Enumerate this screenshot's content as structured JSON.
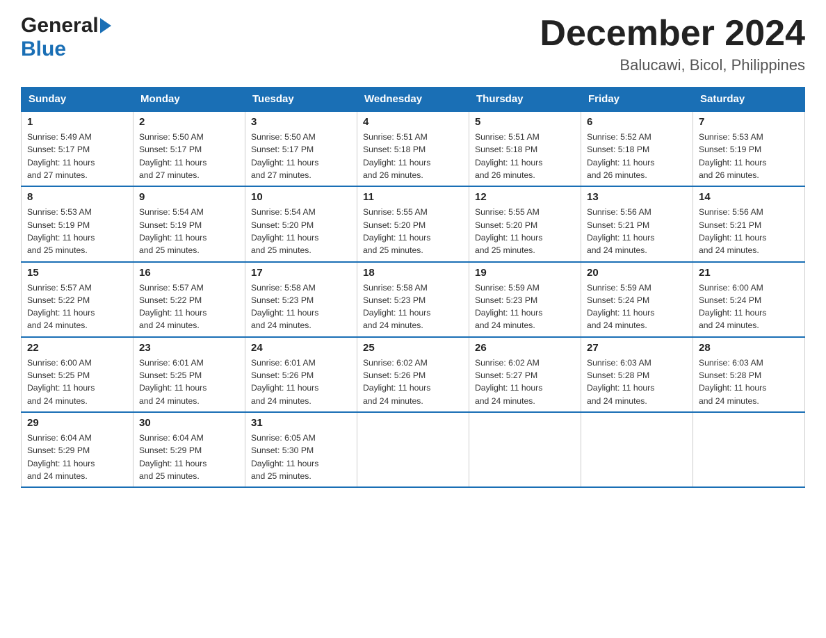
{
  "header": {
    "logo_general": "General",
    "logo_blue": "Blue",
    "title": "December 2024",
    "subtitle": "Balucawi, Bicol, Philippines"
  },
  "days_of_week": [
    "Sunday",
    "Monday",
    "Tuesday",
    "Wednesday",
    "Thursday",
    "Friday",
    "Saturday"
  ],
  "weeks": [
    [
      {
        "day": "1",
        "sunrise": "5:49 AM",
        "sunset": "5:17 PM",
        "daylight": "11 hours and 27 minutes."
      },
      {
        "day": "2",
        "sunrise": "5:50 AM",
        "sunset": "5:17 PM",
        "daylight": "11 hours and 27 minutes."
      },
      {
        "day": "3",
        "sunrise": "5:50 AM",
        "sunset": "5:17 PM",
        "daylight": "11 hours and 27 minutes."
      },
      {
        "day": "4",
        "sunrise": "5:51 AM",
        "sunset": "5:18 PM",
        "daylight": "11 hours and 26 minutes."
      },
      {
        "day": "5",
        "sunrise": "5:51 AM",
        "sunset": "5:18 PM",
        "daylight": "11 hours and 26 minutes."
      },
      {
        "day": "6",
        "sunrise": "5:52 AM",
        "sunset": "5:18 PM",
        "daylight": "11 hours and 26 minutes."
      },
      {
        "day": "7",
        "sunrise": "5:53 AM",
        "sunset": "5:19 PM",
        "daylight": "11 hours and 26 minutes."
      }
    ],
    [
      {
        "day": "8",
        "sunrise": "5:53 AM",
        "sunset": "5:19 PM",
        "daylight": "11 hours and 25 minutes."
      },
      {
        "day": "9",
        "sunrise": "5:54 AM",
        "sunset": "5:19 PM",
        "daylight": "11 hours and 25 minutes."
      },
      {
        "day": "10",
        "sunrise": "5:54 AM",
        "sunset": "5:20 PM",
        "daylight": "11 hours and 25 minutes."
      },
      {
        "day": "11",
        "sunrise": "5:55 AM",
        "sunset": "5:20 PM",
        "daylight": "11 hours and 25 minutes."
      },
      {
        "day": "12",
        "sunrise": "5:55 AM",
        "sunset": "5:20 PM",
        "daylight": "11 hours and 25 minutes."
      },
      {
        "day": "13",
        "sunrise": "5:56 AM",
        "sunset": "5:21 PM",
        "daylight": "11 hours and 24 minutes."
      },
      {
        "day": "14",
        "sunrise": "5:56 AM",
        "sunset": "5:21 PM",
        "daylight": "11 hours and 24 minutes."
      }
    ],
    [
      {
        "day": "15",
        "sunrise": "5:57 AM",
        "sunset": "5:22 PM",
        "daylight": "11 hours and 24 minutes."
      },
      {
        "day": "16",
        "sunrise": "5:57 AM",
        "sunset": "5:22 PM",
        "daylight": "11 hours and 24 minutes."
      },
      {
        "day": "17",
        "sunrise": "5:58 AM",
        "sunset": "5:23 PM",
        "daylight": "11 hours and 24 minutes."
      },
      {
        "day": "18",
        "sunrise": "5:58 AM",
        "sunset": "5:23 PM",
        "daylight": "11 hours and 24 minutes."
      },
      {
        "day": "19",
        "sunrise": "5:59 AM",
        "sunset": "5:23 PM",
        "daylight": "11 hours and 24 minutes."
      },
      {
        "day": "20",
        "sunrise": "5:59 AM",
        "sunset": "5:24 PM",
        "daylight": "11 hours and 24 minutes."
      },
      {
        "day": "21",
        "sunrise": "6:00 AM",
        "sunset": "5:24 PM",
        "daylight": "11 hours and 24 minutes."
      }
    ],
    [
      {
        "day": "22",
        "sunrise": "6:00 AM",
        "sunset": "5:25 PM",
        "daylight": "11 hours and 24 minutes."
      },
      {
        "day": "23",
        "sunrise": "6:01 AM",
        "sunset": "5:25 PM",
        "daylight": "11 hours and 24 minutes."
      },
      {
        "day": "24",
        "sunrise": "6:01 AM",
        "sunset": "5:26 PM",
        "daylight": "11 hours and 24 minutes."
      },
      {
        "day": "25",
        "sunrise": "6:02 AM",
        "sunset": "5:26 PM",
        "daylight": "11 hours and 24 minutes."
      },
      {
        "day": "26",
        "sunrise": "6:02 AM",
        "sunset": "5:27 PM",
        "daylight": "11 hours and 24 minutes."
      },
      {
        "day": "27",
        "sunrise": "6:03 AM",
        "sunset": "5:28 PM",
        "daylight": "11 hours and 24 minutes."
      },
      {
        "day": "28",
        "sunrise": "6:03 AM",
        "sunset": "5:28 PM",
        "daylight": "11 hours and 24 minutes."
      }
    ],
    [
      {
        "day": "29",
        "sunrise": "6:04 AM",
        "sunset": "5:29 PM",
        "daylight": "11 hours and 24 minutes."
      },
      {
        "day": "30",
        "sunrise": "6:04 AM",
        "sunset": "5:29 PM",
        "daylight": "11 hours and 25 minutes."
      },
      {
        "day": "31",
        "sunrise": "6:05 AM",
        "sunset": "5:30 PM",
        "daylight": "11 hours and 25 minutes."
      },
      null,
      null,
      null,
      null
    ]
  ],
  "labels": {
    "sunrise": "Sunrise:",
    "sunset": "Sunset:",
    "daylight": "Daylight:"
  }
}
